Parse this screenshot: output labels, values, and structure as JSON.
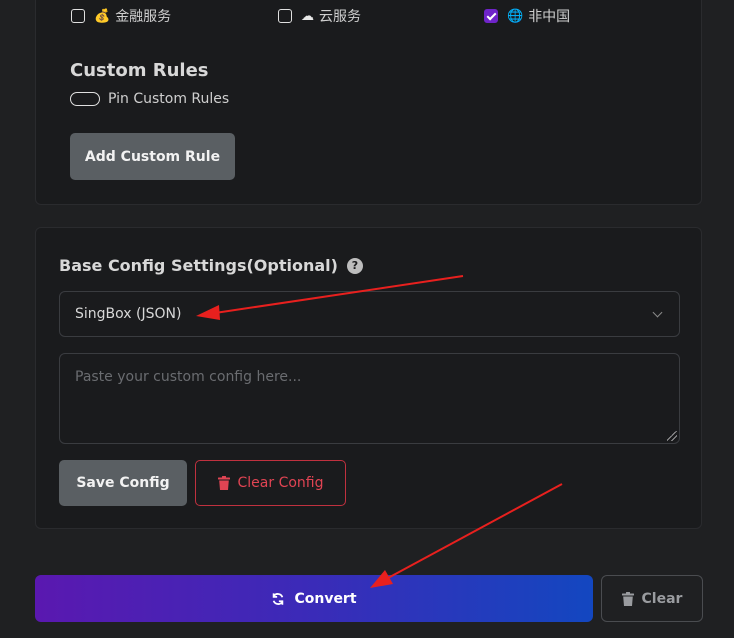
{
  "rule_options": [
    {
      "label": "金融服务",
      "emoji": "💰",
      "checked": false
    },
    {
      "label": "云服务",
      "emoji": "☁",
      "checked": false
    },
    {
      "label": "非中国",
      "emoji": "🌐",
      "checked": true
    }
  ],
  "custom_rules": {
    "title": "Custom Rules",
    "pin_label": "Pin Custom Rules",
    "add_button": "Add Custom Rule"
  },
  "base_config": {
    "title": "Base Config Settings(Optional)",
    "help_glyph": "?",
    "selected_format": "SingBox (JSON)",
    "config_placeholder": "Paste your custom config here...",
    "save_button": "Save Config",
    "clear_button": "Clear Config"
  },
  "actions": {
    "convert_label": "Convert",
    "clear_label": "Clear"
  },
  "colors": {
    "accent_purple": "#6f24c9",
    "danger": "#e04453",
    "annotation_arrow": "#e8201e"
  }
}
